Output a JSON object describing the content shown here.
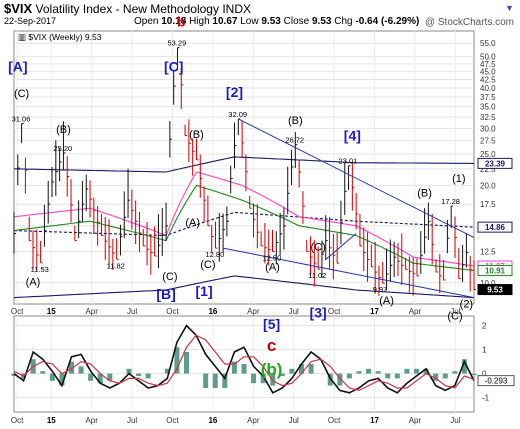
{
  "header": {
    "symbol": "$VIX",
    "name": "Volatility Index - New Methodology",
    "exchange": "INDX",
    "date": "22-Sep-2017",
    "open_label": "Open",
    "open": "10.18",
    "high_label": "High",
    "high": "10.67",
    "low_label": "Low",
    "low": "9.53",
    "close_label": "Close",
    "close": "9.53",
    "chg_label": "Chg",
    "chg": "-0.64 (-6.29%)",
    "watermark": "@ StockCharts.com",
    "legend": "$VIX (Weekly) 9.53",
    "dropdown_icon": "chevron-down-icon"
  },
  "colors": {
    "price_bar": "#111111",
    "down_bar": "#cc0000",
    "wave_label_blue": "#1a1acc",
    "wave_label_red": "#cc0000",
    "wave_label_green": "#22aa22",
    "trend_line": "#2233aa",
    "bollinger_mid": "#ff44cc",
    "ma_short": "#228822",
    "ma_long": "#992222",
    "macd": "#111111",
    "signal": "#cc3344",
    "histogram": "#5e9d8c"
  },
  "chart_data": [
    {
      "type": "line",
      "title": "$VIX Volatility Index - New Methodology INDX",
      "scale": "log",
      "ylim": [
        8.6,
        60
      ],
      "yticks": [
        "55.0",
        "50.0",
        "47.5",
        "45.0",
        "42.5",
        "40.0",
        "37.5",
        "35.0",
        "32.5",
        "30.0",
        "27.5",
        "25.0",
        "22.5",
        "20.0",
        "17.5",
        "15.0",
        "12.5",
        "10.0"
      ],
      "x_ticks": [
        "Oct",
        "15",
        "Apr",
        "Jul",
        "Oct",
        "16",
        "Apr",
        "Jul",
        "Oct",
        "17",
        "Apr",
        "Jul"
      ],
      "right_labels": [
        {
          "text": "23.39",
          "value": 23.39
        },
        {
          "text": "14.86",
          "value": 14.86
        },
        {
          "text": "11.27",
          "value": 11.27
        },
        {
          "text": "10.91",
          "value": 10.91
        },
        {
          "text": "9.53",
          "value": 9.53
        }
      ],
      "price_points": [
        {
          "t": 0,
          "v": 14.2
        },
        {
          "t": 2,
          "v": 31.06
        },
        {
          "t": 4,
          "v": 13.5
        },
        {
          "t": 7,
          "v": 11.53
        },
        {
          "t": 10,
          "v": 20.5
        },
        {
          "t": 13,
          "v": 25.2
        },
        {
          "t": 16,
          "v": 13.5
        },
        {
          "t": 19,
          "v": 19.5
        },
        {
          "t": 23,
          "v": 14.0
        },
        {
          "t": 27,
          "v": 11.82
        },
        {
          "t": 30,
          "v": 18.0
        },
        {
          "t": 34,
          "v": 13.0
        },
        {
          "t": 37,
          "v": 12.1
        },
        {
          "t": 40,
          "v": 15.0
        },
        {
          "t": 43,
          "v": 53.29
        },
        {
          "t": 45,
          "v": 28.5
        },
        {
          "t": 48,
          "v": 24.0
        },
        {
          "t": 51,
          "v": 15.0
        },
        {
          "t": 53,
          "v": 12.8
        },
        {
          "t": 56,
          "v": 15.5
        },
        {
          "t": 59,
          "v": 32.09
        },
        {
          "t": 62,
          "v": 17.0
        },
        {
          "t": 65,
          "v": 13.0
        },
        {
          "t": 68,
          "v": 12.5
        },
        {
          "t": 71,
          "v": 15.0
        },
        {
          "t": 74,
          "v": 26.72
        },
        {
          "t": 77,
          "v": 12.5
        },
        {
          "t": 80,
          "v": 11.02
        },
        {
          "t": 82,
          "v": 13.5
        },
        {
          "t": 85,
          "v": 11.5
        },
        {
          "t": 88,
          "v": 23.01
        },
        {
          "t": 91,
          "v": 13.0
        },
        {
          "t": 94,
          "v": 11.2
        },
        {
          "t": 97,
          "v": 9.97
        },
        {
          "t": 100,
          "v": 12.0
        },
        {
          "t": 103,
          "v": 11.0
        },
        {
          "t": 106,
          "v": 10.5
        },
        {
          "t": 109,
          "v": 15.5
        },
        {
          "t": 111,
          "v": 10.8
        },
        {
          "t": 113,
          "v": 10.2
        },
        {
          "t": 115,
          "v": 17.28
        },
        {
          "t": 117,
          "v": 10.3
        },
        {
          "t": 119,
          "v": 12.4
        },
        {
          "t": 121,
          "v": 9.53
        }
      ],
      "series": [
        {
          "name": "",
          "values": [
            {
              "t": 0,
              "v": 22.5
            },
            {
              "t": 40,
              "v": 22.0
            },
            {
              "t": 58,
              "v": 24.5
            },
            {
              "t": 90,
              "v": 23.5
            },
            {
              "t": 121,
              "v": 23.39
            }
          ]
        },
        {
          "name": "",
          "values": [
            {
              "t": 0,
              "v": 14.5
            },
            {
              "t": 40,
              "v": 14.0
            },
            {
              "t": 58,
              "v": 16.5
            },
            {
              "t": 90,
              "v": 15.5
            },
            {
              "t": 121,
              "v": 14.86
            }
          ]
        },
        {
          "name": "",
          "values": [
            {
              "t": 0,
              "v": 9.0
            },
            {
              "t": 40,
              "v": 9.5
            },
            {
              "t": 58,
              "v": 10.5
            },
            {
              "t": 90,
              "v": 9.5
            },
            {
              "t": 121,
              "v": 9.0
            }
          ]
        },
        {
          "name": "",
          "values": [
            {
              "t": 0,
              "v": 16
            },
            {
              "t": 20,
              "v": 17
            },
            {
              "t": 40,
              "v": 14
            },
            {
              "t": 48,
              "v": 22
            },
            {
              "t": 60,
              "v": 20
            },
            {
              "t": 75,
              "v": 16
            },
            {
              "t": 90,
              "v": 15
            },
            {
              "t": 105,
              "v": 12
            },
            {
              "t": 121,
              "v": 11.27
            }
          ]
        },
        {
          "name": "",
          "values": [
            {
              "t": 0,
              "v": 14.5
            },
            {
              "t": 20,
              "v": 15.5
            },
            {
              "t": 40,
              "v": 13.5
            },
            {
              "t": 48,
              "v": 20
            },
            {
              "t": 60,
              "v": 18
            },
            {
              "t": 75,
              "v": 15
            },
            {
              "t": 90,
              "v": 14
            },
            {
              "t": 105,
              "v": 11.5
            },
            {
              "t": 121,
              "v": 10.91
            }
          ]
        }
      ],
      "trendlines": [
        {
          "from": {
            "t": 59,
            "v": 32.09
          },
          "to": {
            "t": 121,
            "v": 13.8
          }
        },
        {
          "from": {
            "t": 55,
            "v": 12.8
          },
          "to": {
            "t": 121,
            "v": 9.0
          }
        },
        {
          "from": {
            "t": 82,
            "v": 11.8
          },
          "to": {
            "t": 90,
            "v": 14.2
          }
        }
      ],
      "value_labels": [
        {
          "text": "31.06",
          "t": 2,
          "v": 31.06
        },
        {
          "text": "25.20",
          "t": 13,
          "v": 25.2
        },
        {
          "text": "11.53",
          "t": 7,
          "v": 11.53
        },
        {
          "text": "11.82",
          "t": 27,
          "v": 11.82
        },
        {
          "text": "53.29",
          "t": 43,
          "v": 53.29
        },
        {
          "text": "32.09",
          "t": 59,
          "v": 32.09
        },
        {
          "text": "12.80",
          "t": 53,
          "v": 12.8
        },
        {
          "text": "12.50",
          "t": 68,
          "v": 12.5
        },
        {
          "text": "26.72",
          "t": 74,
          "v": 26.72
        },
        {
          "text": "11.02",
          "t": 80,
          "v": 11.02
        },
        {
          "text": "23.01",
          "t": 88,
          "v": 23.01
        },
        {
          "text": "9.97",
          "t": 97,
          "v": 9.97
        },
        {
          "text": "17.28",
          "t": 115,
          "v": 17.28
        }
      ],
      "wave_labels": [
        {
          "text": "[A]",
          "t": 1,
          "v": 45,
          "color": "blue",
          "size": "l"
        },
        {
          "text": "(C)",
          "t": 2,
          "v": 37.5,
          "color": "black",
          "size": "m"
        },
        {
          "text": "(B)",
          "t": 13,
          "v": 29,
          "color": "black",
          "size": "m"
        },
        {
          "text": "(A)",
          "t": 5,
          "v": 9.8,
          "color": "black",
          "size": "m"
        },
        {
          "text": "[C]",
          "t": 42,
          "v": 45,
          "color": "blue",
          "size": "l"
        },
        {
          "text": "b",
          "t": 44,
          "v": 62,
          "color": "red",
          "size": "l"
        },
        {
          "text": "(B)",
          "t": 48,
          "v": 28,
          "color": "black",
          "size": "m"
        },
        {
          "text": "(A)",
          "t": 47,
          "v": 15.0,
          "color": "black",
          "size": "m"
        },
        {
          "text": "(C)",
          "t": 41,
          "v": 10.2,
          "color": "black",
          "size": "m"
        },
        {
          "text": "(C)",
          "t": 51,
          "v": 11.1,
          "color": "black",
          "size": "m"
        },
        {
          "text": "[B]",
          "t": 40,
          "v": 8.9,
          "color": "blue",
          "size": "l"
        },
        {
          "text": "[1]",
          "t": 50,
          "v": 9.1,
          "color": "blue",
          "size": "l"
        },
        {
          "text": "[2]",
          "t": 58,
          "v": 37.5,
          "color": "blue",
          "size": "l"
        },
        {
          "text": "(A)",
          "t": 68,
          "v": 10.9,
          "color": "black",
          "size": "m"
        },
        {
          "text": "(B)",
          "t": 74,
          "v": 31,
          "color": "black",
          "size": "m"
        },
        {
          "text": "(C)",
          "t": 80,
          "v": 12.6,
          "color": "black",
          "size": "m"
        },
        {
          "text": "[3]",
          "t": 80,
          "v": 7.8,
          "color": "blue",
          "size": "l"
        },
        {
          "text": "[4]",
          "t": 89,
          "v": 27.5,
          "color": "blue",
          "size": "l"
        },
        {
          "text": "(A)",
          "t": 98,
          "v": 8.6,
          "color": "black",
          "size": "m"
        },
        {
          "text": "(B)",
          "t": 108,
          "v": 18.5,
          "color": "black",
          "size": "m"
        },
        {
          "text": "(1)",
          "t": 117,
          "v": 20.5,
          "color": "black",
          "size": "m"
        },
        {
          "text": "(C)",
          "t": 116,
          "v": 7.7,
          "color": "black",
          "size": "m"
        },
        {
          "text": "(2)",
          "t": 119,
          "v": 8.4,
          "color": "black",
          "size": "m"
        }
      ]
    },
    {
      "type": "line",
      "title": "",
      "ylim": [
        -1.6,
        2.4
      ],
      "yticks": [
        "2",
        "1",
        "0",
        "-1"
      ],
      "x_ticks": [
        "Oct",
        "15",
        "Apr",
        "Jul",
        "Oct",
        "16",
        "Apr",
        "Jul",
        "Oct",
        "17",
        "Apr",
        "Jul"
      ],
      "right_labels": [
        {
          "text": "-0.293",
          "value": -0.293
        }
      ],
      "series": [
        {
          "name": "",
          "values": [
            0,
            -0.3,
            0.9,
            0.6,
            0.1,
            -0.5,
            0.7,
            0.8,
            0.1,
            -0.4,
            -0.6,
            -0.4,
            0.0,
            -0.3,
            -0.6,
            -0.5,
            -0.2,
            1.3,
            2.0,
            1.6,
            0.8,
            0.3,
            -0.2,
            0.9,
            1.1,
            0.3,
            -0.1,
            -0.8,
            -0.6,
            -0.2,
            0.4,
            0.9,
            0.6,
            -0.2,
            -0.7,
            -0.8,
            -0.6,
            -0.3,
            -0.2,
            -0.6,
            -0.8,
            -0.4,
            -0.1,
            0.2,
            -0.5,
            -0.7,
            -0.5,
            0.5,
            -0.293
          ]
        },
        {
          "name": "",
          "values": [
            0.1,
            -0.1,
            0.3,
            0.5,
            0.4,
            0.0,
            0.2,
            0.5,
            0.4,
            0.0,
            -0.3,
            -0.4,
            -0.2,
            -0.2,
            -0.4,
            -0.5,
            -0.4,
            0.2,
            1.1,
            1.6,
            1.4,
            0.9,
            0.4,
            0.4,
            0.7,
            0.7,
            0.3,
            -0.3,
            -0.5,
            -0.4,
            0.0,
            0.5,
            0.6,
            0.3,
            -0.2,
            -0.6,
            -0.7,
            -0.5,
            -0.3,
            -0.4,
            -0.6,
            -0.6,
            -0.3,
            0.0,
            -0.2,
            -0.5,
            -0.6,
            -0.1,
            -0.24
          ]
        }
      ],
      "wave_labels": [
        {
          "text": "[5]",
          "pos": 0.56,
          "v": 1.85,
          "color": "blue",
          "size": "l"
        },
        {
          "text": "c",
          "pos": 0.56,
          "v": 0.95,
          "color": "red",
          "size": "xl"
        },
        {
          "text": "(b)",
          "pos": 0.56,
          "v": -0.05,
          "color": "green",
          "size": "xl"
        }
      ]
    }
  ]
}
